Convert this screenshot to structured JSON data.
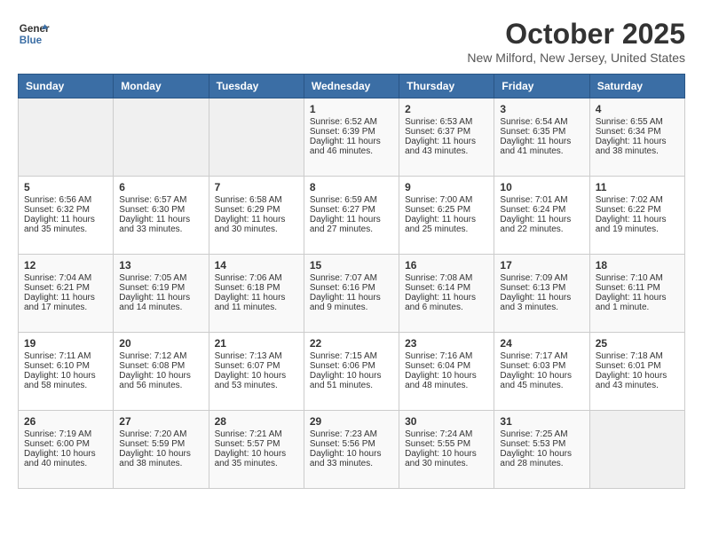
{
  "header": {
    "logo_line1": "General",
    "logo_line2": "Blue",
    "month": "October 2025",
    "location": "New Milford, New Jersey, United States"
  },
  "weekdays": [
    "Sunday",
    "Monday",
    "Tuesday",
    "Wednesday",
    "Thursday",
    "Friday",
    "Saturday"
  ],
  "weeks": [
    [
      {
        "day": "",
        "text": ""
      },
      {
        "day": "",
        "text": ""
      },
      {
        "day": "",
        "text": ""
      },
      {
        "day": "1",
        "text": "Sunrise: 6:52 AM\nSunset: 6:39 PM\nDaylight: 11 hours and 46 minutes."
      },
      {
        "day": "2",
        "text": "Sunrise: 6:53 AM\nSunset: 6:37 PM\nDaylight: 11 hours and 43 minutes."
      },
      {
        "day": "3",
        "text": "Sunrise: 6:54 AM\nSunset: 6:35 PM\nDaylight: 11 hours and 41 minutes."
      },
      {
        "day": "4",
        "text": "Sunrise: 6:55 AM\nSunset: 6:34 PM\nDaylight: 11 hours and 38 minutes."
      }
    ],
    [
      {
        "day": "5",
        "text": "Sunrise: 6:56 AM\nSunset: 6:32 PM\nDaylight: 11 hours and 35 minutes."
      },
      {
        "day": "6",
        "text": "Sunrise: 6:57 AM\nSunset: 6:30 PM\nDaylight: 11 hours and 33 minutes."
      },
      {
        "day": "7",
        "text": "Sunrise: 6:58 AM\nSunset: 6:29 PM\nDaylight: 11 hours and 30 minutes."
      },
      {
        "day": "8",
        "text": "Sunrise: 6:59 AM\nSunset: 6:27 PM\nDaylight: 11 hours and 27 minutes."
      },
      {
        "day": "9",
        "text": "Sunrise: 7:00 AM\nSunset: 6:25 PM\nDaylight: 11 hours and 25 minutes."
      },
      {
        "day": "10",
        "text": "Sunrise: 7:01 AM\nSunset: 6:24 PM\nDaylight: 11 hours and 22 minutes."
      },
      {
        "day": "11",
        "text": "Sunrise: 7:02 AM\nSunset: 6:22 PM\nDaylight: 11 hours and 19 minutes."
      }
    ],
    [
      {
        "day": "12",
        "text": "Sunrise: 7:04 AM\nSunset: 6:21 PM\nDaylight: 11 hours and 17 minutes."
      },
      {
        "day": "13",
        "text": "Sunrise: 7:05 AM\nSunset: 6:19 PM\nDaylight: 11 hours and 14 minutes."
      },
      {
        "day": "14",
        "text": "Sunrise: 7:06 AM\nSunset: 6:18 PM\nDaylight: 11 hours and 11 minutes."
      },
      {
        "day": "15",
        "text": "Sunrise: 7:07 AM\nSunset: 6:16 PM\nDaylight: 11 hours and 9 minutes."
      },
      {
        "day": "16",
        "text": "Sunrise: 7:08 AM\nSunset: 6:14 PM\nDaylight: 11 hours and 6 minutes."
      },
      {
        "day": "17",
        "text": "Sunrise: 7:09 AM\nSunset: 6:13 PM\nDaylight: 11 hours and 3 minutes."
      },
      {
        "day": "18",
        "text": "Sunrise: 7:10 AM\nSunset: 6:11 PM\nDaylight: 11 hours and 1 minute."
      }
    ],
    [
      {
        "day": "19",
        "text": "Sunrise: 7:11 AM\nSunset: 6:10 PM\nDaylight: 10 hours and 58 minutes."
      },
      {
        "day": "20",
        "text": "Sunrise: 7:12 AM\nSunset: 6:08 PM\nDaylight: 10 hours and 56 minutes."
      },
      {
        "day": "21",
        "text": "Sunrise: 7:13 AM\nSunset: 6:07 PM\nDaylight: 10 hours and 53 minutes."
      },
      {
        "day": "22",
        "text": "Sunrise: 7:15 AM\nSunset: 6:06 PM\nDaylight: 10 hours and 51 minutes."
      },
      {
        "day": "23",
        "text": "Sunrise: 7:16 AM\nSunset: 6:04 PM\nDaylight: 10 hours and 48 minutes."
      },
      {
        "day": "24",
        "text": "Sunrise: 7:17 AM\nSunset: 6:03 PM\nDaylight: 10 hours and 45 minutes."
      },
      {
        "day": "25",
        "text": "Sunrise: 7:18 AM\nSunset: 6:01 PM\nDaylight: 10 hours and 43 minutes."
      }
    ],
    [
      {
        "day": "26",
        "text": "Sunrise: 7:19 AM\nSunset: 6:00 PM\nDaylight: 10 hours and 40 minutes."
      },
      {
        "day": "27",
        "text": "Sunrise: 7:20 AM\nSunset: 5:59 PM\nDaylight: 10 hours and 38 minutes."
      },
      {
        "day": "28",
        "text": "Sunrise: 7:21 AM\nSunset: 5:57 PM\nDaylight: 10 hours and 35 minutes."
      },
      {
        "day": "29",
        "text": "Sunrise: 7:23 AM\nSunset: 5:56 PM\nDaylight: 10 hours and 33 minutes."
      },
      {
        "day": "30",
        "text": "Sunrise: 7:24 AM\nSunset: 5:55 PM\nDaylight: 10 hours and 30 minutes."
      },
      {
        "day": "31",
        "text": "Sunrise: 7:25 AM\nSunset: 5:53 PM\nDaylight: 10 hours and 28 minutes."
      },
      {
        "day": "",
        "text": ""
      }
    ]
  ]
}
